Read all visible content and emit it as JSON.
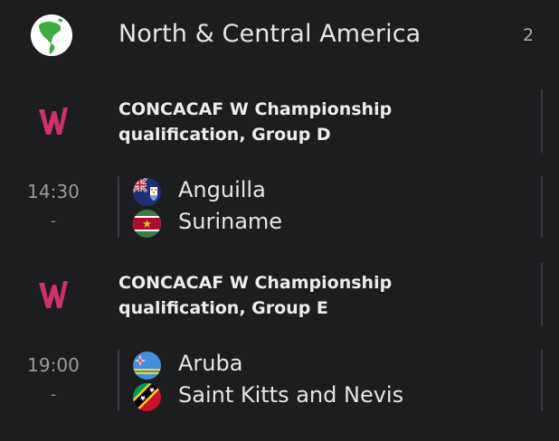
{
  "region": {
    "title": "North & Central America",
    "count": "2",
    "icon": "globe-americas-icon"
  },
  "leagues": [
    {
      "name_line1": "CONCACAF W Championship",
      "name_line2": "qualification, Group D",
      "logo": "concacaf-w-logo-icon",
      "logo_color": "#d1306b",
      "match": {
        "time": "14:30",
        "status": "-",
        "home": {
          "name": "Anguilla",
          "flag": "anguilla-flag-icon"
        },
        "away": {
          "name": "Suriname",
          "flag": "suriname-flag-icon"
        }
      }
    },
    {
      "name_line1": "CONCACAF W Championship",
      "name_line2": "qualification, Group E",
      "logo": "concacaf-w-logo-icon",
      "logo_color": "#d1306b",
      "match": {
        "time": "19:00",
        "status": "-",
        "home": {
          "name": "Aruba",
          "flag": "aruba-flag-icon"
        },
        "away": {
          "name": "Saint Kitts and Nevis",
          "flag": "saint-kitts-and-nevis-flag-icon"
        }
      }
    }
  ]
}
